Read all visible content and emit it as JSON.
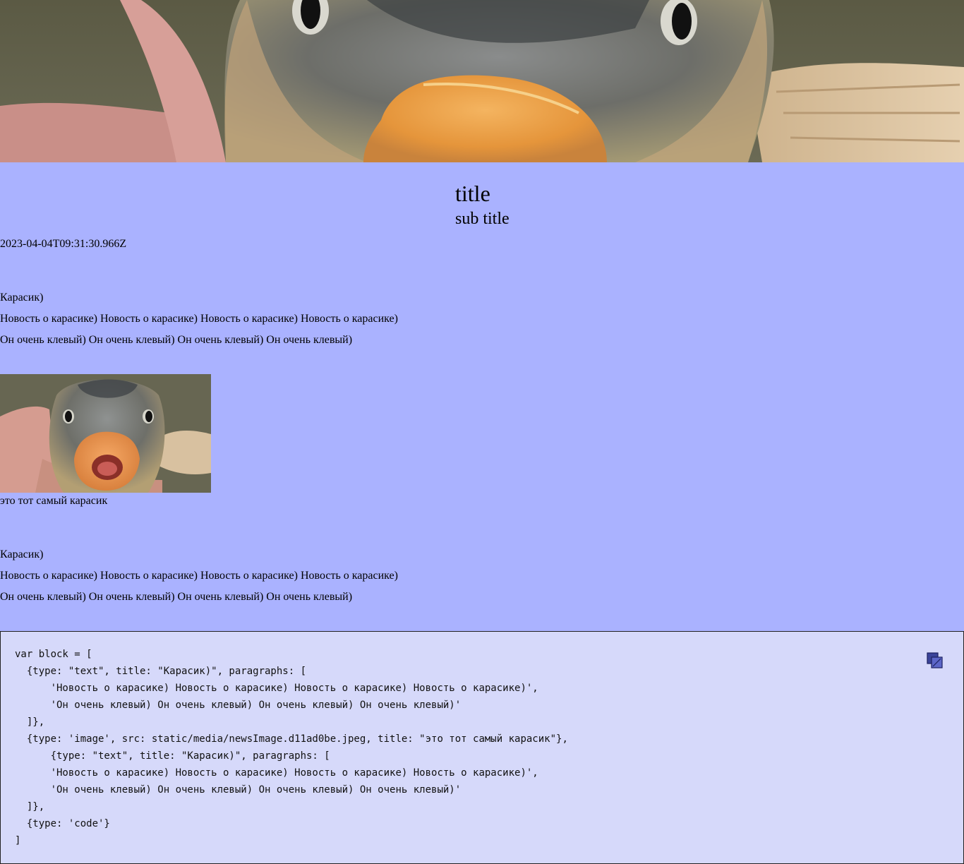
{
  "article": {
    "title": "title",
    "subtitle": "sub title",
    "date": "2023-04-04T09:31:30.966Z"
  },
  "blocks": [
    {
      "type": "text",
      "title": "Карасик)",
      "paragraphs": [
        "Новость о карасике) Новость о карасике) Новость о карасике) Новость о карасике)",
        "Он очень клевый) Он очень клевый) Он очень клевый) Он очень клевый)"
      ]
    },
    {
      "type": "image",
      "image_subject": "carp fish held in hand",
      "title": "это тот самый карасик"
    },
    {
      "type": "text",
      "title": "Карасик)",
      "paragraphs": [
        "Новость о карасике) Новость о карасике) Новость о карасике) Новость о карасике)",
        "Он очень клевый) Он очень клевый) Он очень клевый) Он очень клевый)"
      ]
    },
    {
      "type": "code",
      "code": "var block = [\n  {type: \"text\", title: \"Карасик)\", paragraphs: [\n      'Новость о карасике) Новость о карасике) Новость о карасике) Новость о карасике)',\n      'Он очень клевый) Он очень клевый) Он очень клевый) Он очень клевый)'\n  ]},\n  {type: 'image', src: static/media/newsImage.d11ad0be.jpeg, title: \"это тот самый карасик\"},\n      {type: \"text\", title: \"Карасик)\", paragraphs: [\n      'Новость о карасике) Новость о карасике) Новость о карасике) Новость о карасике)',\n      'Он очень клевый) Он очень клевый) Он очень клевый) Он очень клевый)'\n  ]},\n  {type: 'code'}\n]",
      "copy_icon": "copy-icon"
    }
  ],
  "hero": {
    "image_subject": "carp fish close-up"
  },
  "colors": {
    "page_background": "#aab2ff",
    "code_background": "#d6d9fa",
    "copy_icon_fill": "#3a4399"
  }
}
